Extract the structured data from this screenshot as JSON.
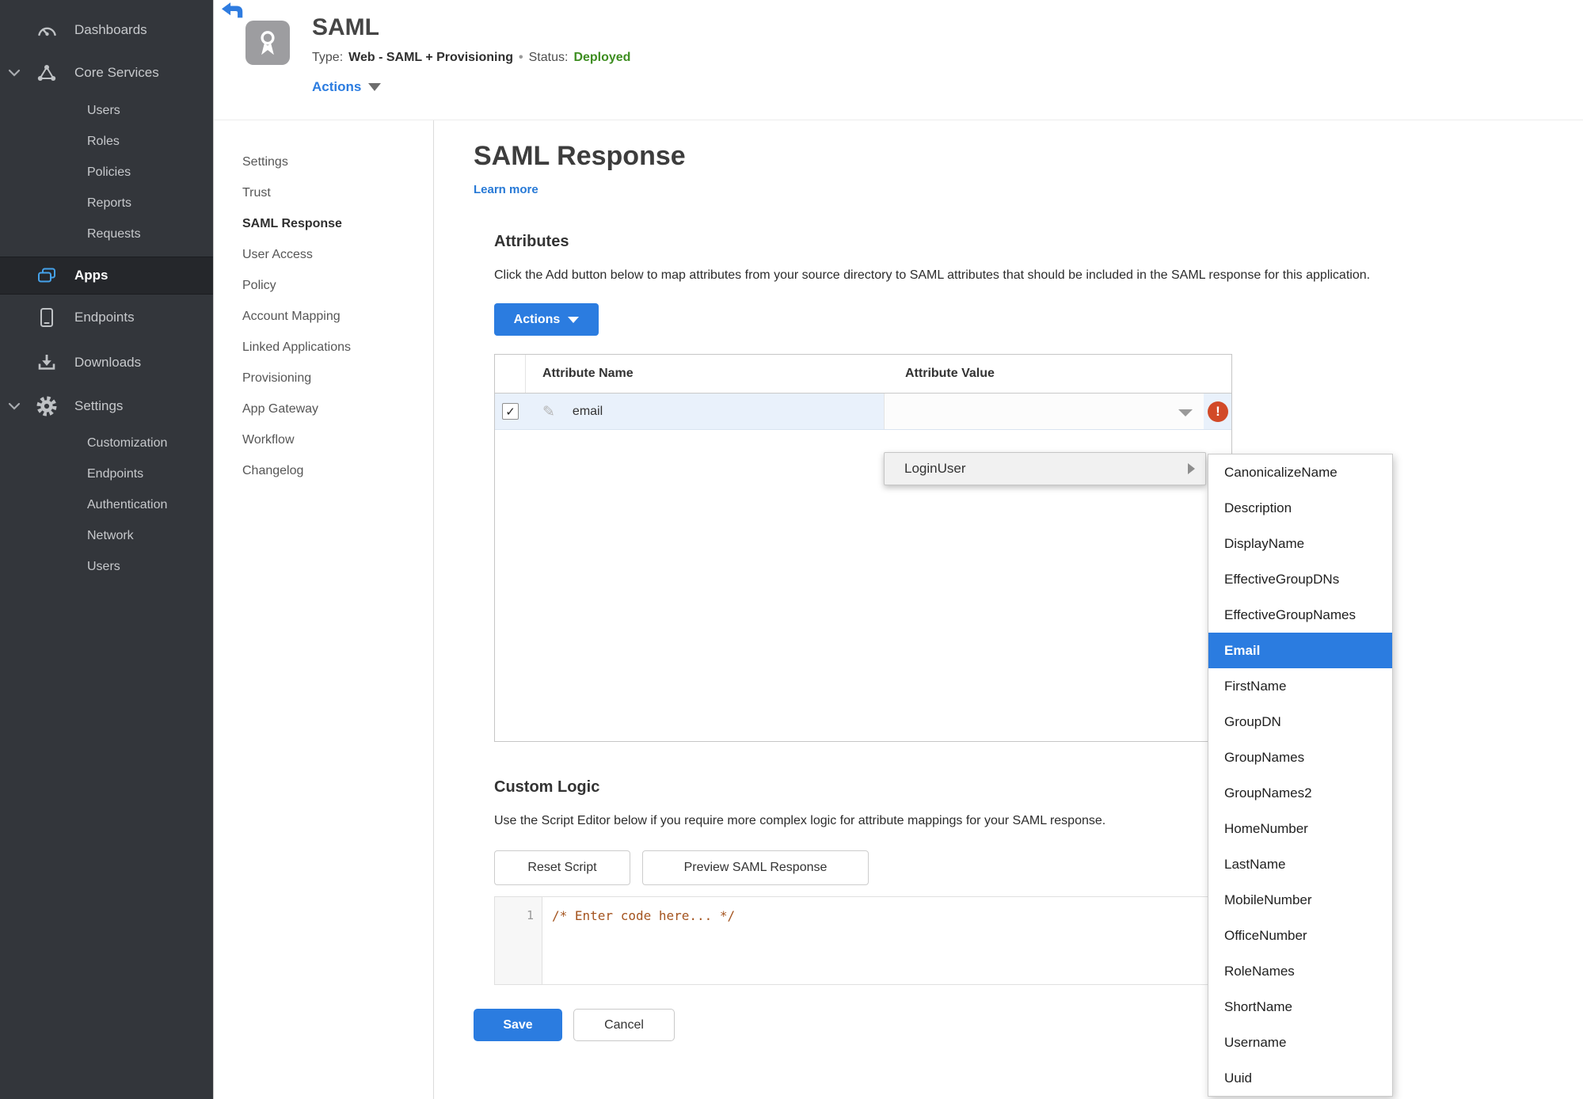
{
  "colors": {
    "accent_blue": "#2b7ce0",
    "status_green": "#3e8e21",
    "error_red": "#d24a28",
    "row_highlight": "#e9f1fb",
    "sidebar_bg": "#33363b",
    "code_comment": "#a4541f"
  },
  "glyphs": {
    "check": "✓",
    "error": "!",
    "pencil": "✎",
    "dot": "•"
  },
  "sidebar": {
    "items": [
      {
        "label": "Dashboards",
        "icon": "gauge-icon"
      },
      {
        "label": "Core Services",
        "icon": "core-services-icon",
        "expanded": true,
        "children": [
          {
            "label": "Users"
          },
          {
            "label": "Roles"
          },
          {
            "label": "Policies"
          },
          {
            "label": "Reports"
          },
          {
            "label": "Requests"
          }
        ]
      },
      {
        "label": "Apps",
        "icon": "apps-icon",
        "active": true
      },
      {
        "label": "Endpoints",
        "icon": "endpoints-icon"
      },
      {
        "label": "Downloads",
        "icon": "downloads-icon"
      },
      {
        "label": "Settings",
        "icon": "gear-icon",
        "expanded": true,
        "children": [
          {
            "label": "Customization"
          },
          {
            "label": "Endpoints"
          },
          {
            "label": "Authentication"
          },
          {
            "label": "Network"
          },
          {
            "label": "Users"
          }
        ]
      }
    ]
  },
  "header": {
    "title": "SAML",
    "type_label": "Type:",
    "type_value": "Web - SAML + Provisioning",
    "status_label": "Status:",
    "status_value": "Deployed",
    "actions_label": "Actions"
  },
  "subnav": {
    "active": "SAML Response",
    "items": [
      "Settings",
      "Trust",
      "SAML Response",
      "User Access",
      "Policy",
      "Account Mapping",
      "Linked Applications",
      "Provisioning",
      "App Gateway",
      "Workflow",
      "Changelog"
    ]
  },
  "main": {
    "title": "SAML Response",
    "learn_more": "Learn more",
    "attributes": {
      "heading": "Attributes",
      "description": "Click the Add button below to map attributes from your source directory to SAML attributes that should be included in the SAML response for this application.",
      "actions_button": "Actions",
      "table": {
        "columns": [
          "Attribute Name",
          "Attribute Value"
        ],
        "rows": [
          {
            "name": "email",
            "value": "",
            "checked": true,
            "error": true
          }
        ]
      }
    },
    "custom_logic": {
      "heading": "Custom Logic",
      "description": "Use the Script Editor below if you require more complex logic for attribute mappings for your SAML response.",
      "reset_button": "Reset Script",
      "preview_button": "Preview SAML Response",
      "editor": {
        "line_number": "1",
        "code": "/* Enter code here... */"
      }
    },
    "save_button": "Save",
    "cancel_button": "Cancel"
  },
  "dropdown": {
    "parent": "LoginUser",
    "selected": "Email",
    "items": [
      "CanonicalizeName",
      "Description",
      "DisplayName",
      "EffectiveGroupDNs",
      "EffectiveGroupNames",
      "Email",
      "FirstName",
      "GroupDN",
      "GroupNames",
      "GroupNames2",
      "HomeNumber",
      "LastName",
      "MobileNumber",
      "OfficeNumber",
      "RoleNames",
      "ShortName",
      "Username",
      "Uuid"
    ]
  }
}
